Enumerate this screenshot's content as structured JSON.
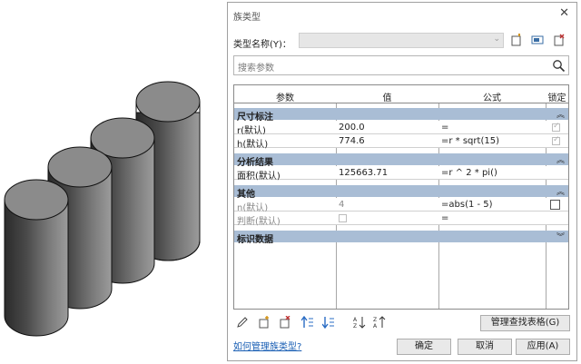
{
  "dialog": {
    "title": "族类型",
    "type_name_label": "类型名称(Y)：",
    "type_name_value": "",
    "search_placeholder": "搜索参数",
    "columns": [
      "参数",
      "值",
      "公式",
      "锁定"
    ],
    "groups": [
      {
        "name": "尺寸标注",
        "expanded": true,
        "rows": [
          {
            "param": "r(默认)",
            "value": "200.0",
            "formula": "=",
            "locked": true
          },
          {
            "param": "h(默认)",
            "value": "774.6",
            "formula": "=r * sqrt(15)",
            "locked": true
          }
        ]
      },
      {
        "name": "分析结果",
        "expanded": true,
        "rows": [
          {
            "param": "面积(默认)",
            "value": "125663.71",
            "formula": "=r ^ 2 * pi()",
            "locked": null
          }
        ]
      },
      {
        "name": "其他",
        "expanded": true,
        "rows": [
          {
            "param": "n(默认)",
            "value": "4",
            "formula": "=abs(1 - 5)",
            "locked": false
          },
          {
            "param": "判断(默认)",
            "value": "",
            "formula": "=",
            "locked": null
          }
        ]
      },
      {
        "name": "标识数据",
        "expanded": false,
        "rows": []
      }
    ],
    "manage_lookup_button": "管理查找表格(G)",
    "help_link": "如何管理族类型?",
    "ok_button": "确定",
    "cancel_button": "取消",
    "apply_button": "应用(A)"
  },
  "icons": {
    "top": [
      "new-type-icon",
      "rename-type-icon",
      "delete-type-icon"
    ],
    "toolbar": [
      "edit-parameter-icon",
      "new-parameter-icon",
      "delete-parameter-icon",
      "move-up-icon",
      "move-down-icon",
      "sort-ascending-icon",
      "sort-descending-icon"
    ]
  },
  "scene": {
    "description_colors": {
      "cylinder_top": "#8a8a8a",
      "cylinder_side_dark": "#2a2a2a",
      "cylinder_side_light": "#9a9a9a"
    }
  }
}
